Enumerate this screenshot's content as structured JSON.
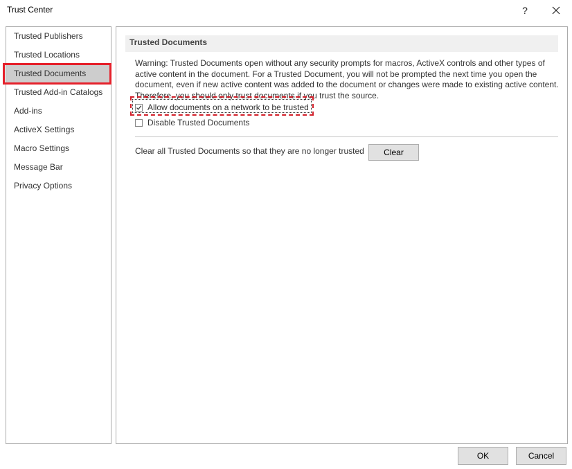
{
  "window": {
    "title": "Trust Center",
    "help_glyph": "?",
    "close_icon": "close-icon"
  },
  "sidebar": {
    "items": [
      {
        "label": "Trusted Publishers"
      },
      {
        "label": "Trusted Locations"
      },
      {
        "label": "Trusted Documents",
        "selected": true
      },
      {
        "label": "Trusted Add-in Catalogs"
      },
      {
        "label": "Add-ins"
      },
      {
        "label": "ActiveX Settings"
      },
      {
        "label": "Macro Settings"
      },
      {
        "label": "Message Bar"
      },
      {
        "label": "Privacy Options"
      }
    ]
  },
  "main": {
    "section_title": "Trusted Documents",
    "warning_text": "Warning: Trusted Documents open without any security prompts for macros, ActiveX controls and other types of active content in the document.  For a Trusted Document, you will not be prompted the next time you open the document, even if new active content was added to the document or changes were made to existing active content. Therefore, you should only trust documents if you trust the source.",
    "checkbox_allow_network": {
      "label": "Allow documents on a network to be trusted",
      "checked": true
    },
    "checkbox_disable": {
      "label": "Disable Trusted Documents",
      "checked": false
    },
    "clear_description": "Clear all Trusted Documents so that they are no longer trusted",
    "clear_button": "Clear"
  },
  "footer": {
    "ok_label": "OK",
    "cancel_label": "Cancel"
  },
  "colors": {
    "highlight_red": "#e5202a",
    "selected_bg": "#cdcdcd",
    "header_bg": "#f0f0f0"
  }
}
